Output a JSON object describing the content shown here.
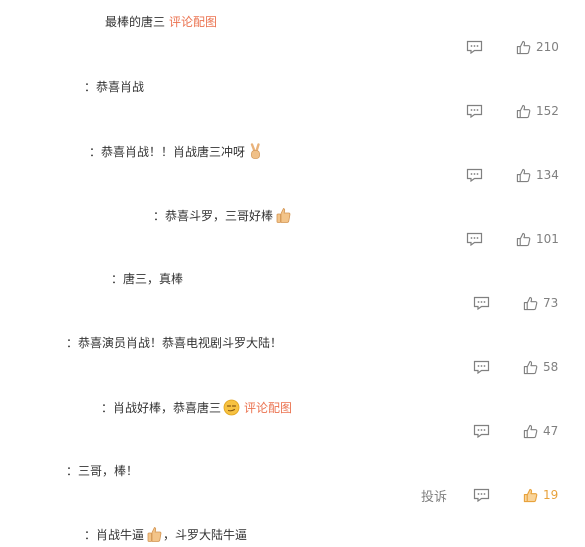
{
  "colors": {
    "accent_link": "#eb7350",
    "text": "#333333",
    "muted": "#808080",
    "liked": "#e8a23c"
  },
  "comments": [
    {
      "text": "最棒的唐三",
      "link": "评论配图",
      "likes": "210"
    },
    {
      "text": "：恭喜肖战",
      "likes": "152"
    },
    {
      "text": "：恭喜肖战！！肖战唐三冲呀",
      "emoji": "victory-hand-icon",
      "likes": "134"
    },
    {
      "text": "：恭喜斗罗，三哥好棒",
      "emoji": "thumbs-up-emoji-icon",
      "likes": "101"
    },
    {
      "text": "：唐三，真棒",
      "likes": "73"
    },
    {
      "text": "：恭喜演员肖战！恭喜电视剧斗罗大陆！",
      "likes": "58"
    },
    {
      "text": "：肖战好棒，恭喜唐三",
      "emoji": "smirk-face-icon",
      "link": "评论配图",
      "likes": "47"
    },
    {
      "text": "：三哥，棒！",
      "report": "投诉",
      "likes": "19",
      "liked": true
    },
    {
      "text": "：肖战牛逼",
      "emoji": "thumbs-up-emoji-icon",
      "text2": "，斗罗大陆牛逼"
    }
  ]
}
